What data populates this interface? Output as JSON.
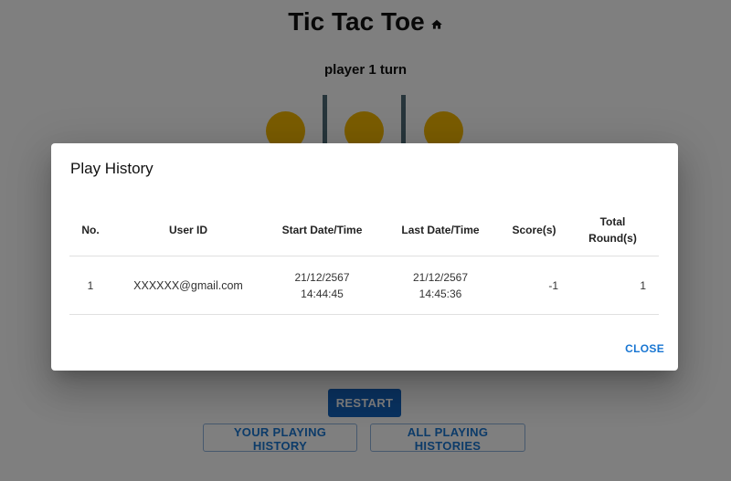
{
  "page": {
    "title": "Tic Tac Toe",
    "turn_text": "player 1 turn",
    "restart_label": "RESTART",
    "your_history_label": "YOUR PLAYING HISTORY",
    "all_histories_label": "ALL PLAYING HISTORIES"
  },
  "dialog": {
    "title": "Play History",
    "close_label": "CLOSE",
    "columns": {
      "no": "No.",
      "user_id": "User ID",
      "start": "Start Date/Time",
      "last": "Last Date/Time",
      "score": "Score(s)",
      "total_line1": "Total",
      "total_line2": "Round(s)"
    },
    "rows": [
      {
        "no": "1",
        "user_id": "XXXXXX@gmail.com",
        "start_date": "21/12/2567",
        "start_time": "14:44:45",
        "last_date": "21/12/2567",
        "last_time": "14:45:36",
        "score": "-1",
        "total_rounds": "1"
      }
    ]
  },
  "colors": {
    "primary": "#1565c0",
    "board_piece": "#f5b800",
    "board_line": "#4e6a77",
    "backdrop": "rgba(0,0,0,0.5)"
  },
  "icons": {
    "home": "home-icon"
  }
}
